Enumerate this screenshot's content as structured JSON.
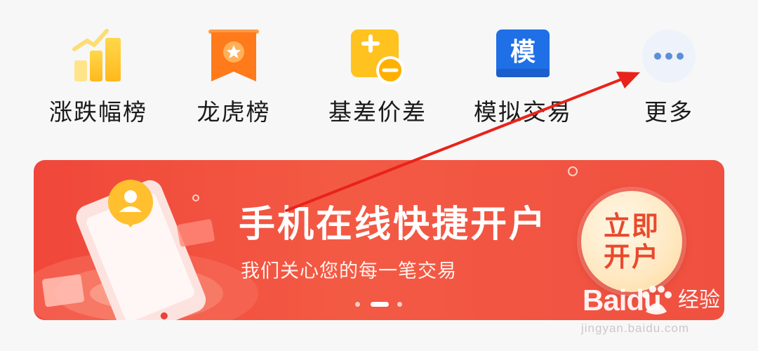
{
  "nav": {
    "items": [
      {
        "label": "涨跌幅榜",
        "icon": "bar-chart-trend-icon"
      },
      {
        "label": "龙虎榜",
        "icon": "ribbon-star-icon"
      },
      {
        "label": "基差价差",
        "icon": "plus-minus-icon"
      },
      {
        "label": "模拟交易",
        "icon": "mo-character-icon",
        "icon_text": "模"
      },
      {
        "label": "更多",
        "icon": "more-dots-icon"
      }
    ]
  },
  "banner": {
    "title": "手机在线快捷开户",
    "subtitle": "我们关心您的每一笔交易",
    "cta_line1": "立即",
    "cta_line2": "开户",
    "slide_count": 3,
    "active_slide": 2
  },
  "watermark": {
    "brand": "Baidu",
    "text": "经验",
    "url": "jingyan.baidu.com"
  },
  "colors": {
    "banner_red": "#f0473a",
    "annotation_arrow": "#e8231a",
    "cta_text": "#e94a2e",
    "nav_blue": "#1a73e8",
    "nav_orange": "#ff7a1a",
    "nav_yellow": "#ffc21f"
  }
}
